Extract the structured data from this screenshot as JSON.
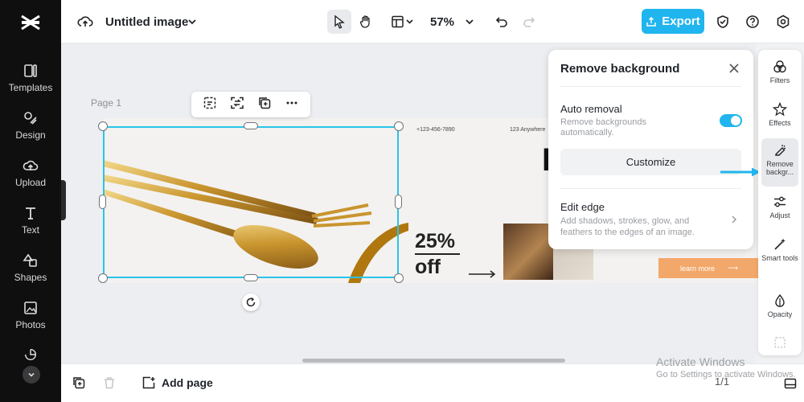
{
  "sidebar": {
    "items": [
      {
        "label": "Templates"
      },
      {
        "label": "Design"
      },
      {
        "label": "Upload"
      },
      {
        "label": "Text"
      },
      {
        "label": "Shapes"
      },
      {
        "label": "Photos"
      }
    ]
  },
  "header": {
    "title": "Untitled image",
    "zoom": "57%",
    "export_label": "Export"
  },
  "canvas": {
    "page_label": "Page 1",
    "design": {
      "phone": "+123-456-7890",
      "address": "123 Anywhere",
      "promo_line1": "25%",
      "promo_line2": "off",
      "big_letter": "K",
      "learn_more": "learn more",
      "learn_arrow": "⟶"
    }
  },
  "remove_bg_panel": {
    "title": "Remove background",
    "auto_removal": {
      "title": "Auto removal",
      "description": "Remove backgrounds automatically.",
      "enabled": true
    },
    "customize_label": "Customize",
    "edit_edge": {
      "title": "Edit edge",
      "description": "Add shadows, strokes, glow, and feathers to the edges of an image."
    }
  },
  "tool_rail": {
    "items": [
      {
        "label": "Filters"
      },
      {
        "label": "Effects"
      },
      {
        "label": "Remove backgr..."
      },
      {
        "label": "Adjust"
      },
      {
        "label": "Smart tools"
      },
      {
        "label": "Opacity"
      }
    ]
  },
  "bottom": {
    "add_page_label": "Add page",
    "pager": "1/1"
  },
  "watermark": {
    "line1": "Activate Windows",
    "line2": "Go to Settings to activate Windows."
  },
  "colors": {
    "accent": "#20b5ee",
    "selection": "#2bc3e8",
    "sidebar_bg": "#0f0f10",
    "promo_button": "#f2a86a"
  }
}
